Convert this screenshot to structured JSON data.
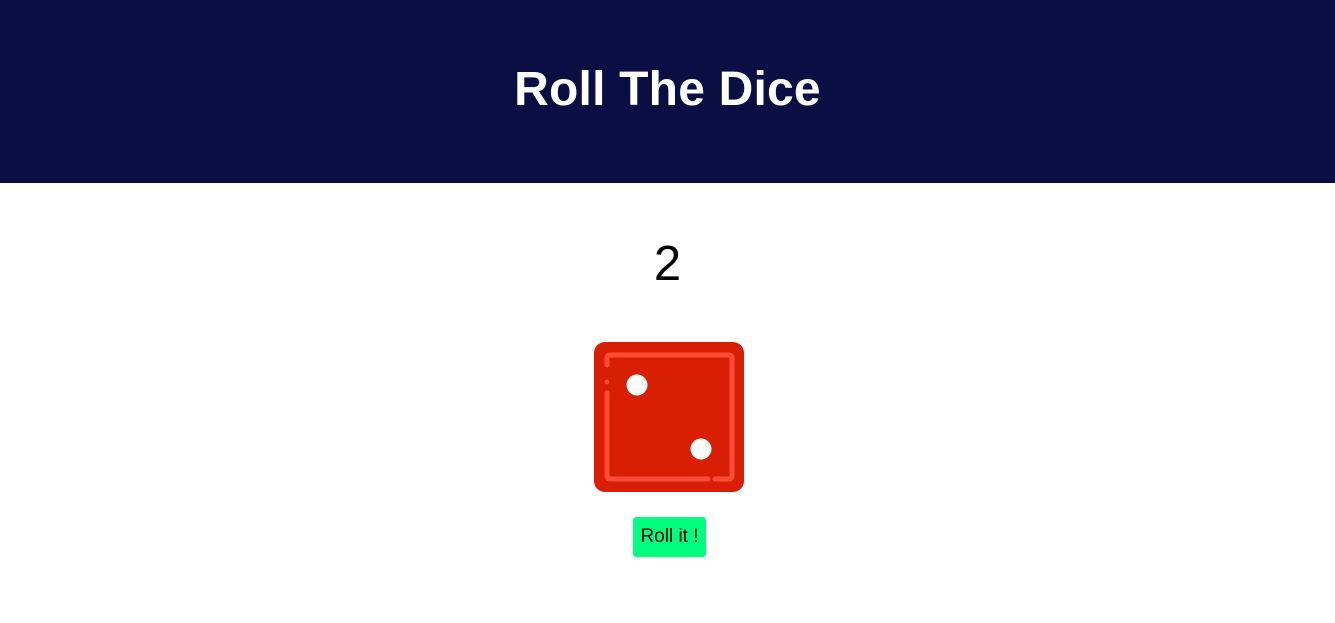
{
  "header": {
    "title": "Roll The Dice"
  },
  "dice": {
    "result": "2",
    "icon": "dice-two-icon",
    "face_color": "#d81f03",
    "border_color": "#ff4c37",
    "pip_color": "#ffffff"
  },
  "actions": {
    "roll_label": "Roll it !",
    "button_color": "#00ff7f"
  },
  "colors": {
    "header_background": "#0a0e42",
    "page_background": "#ffffff"
  }
}
